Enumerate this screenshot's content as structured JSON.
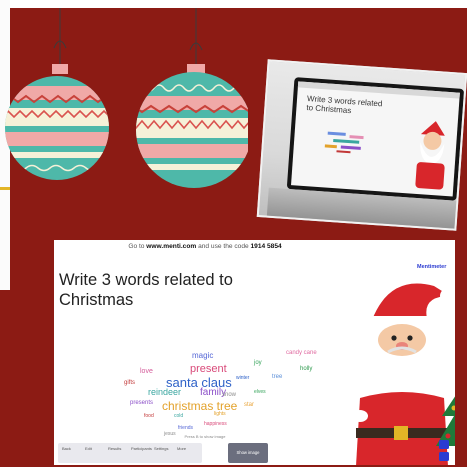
{
  "slide": {
    "code_prefix": "Go to ",
    "url": "www.menti.com",
    "code_middle": " and use the code ",
    "code": "1914 5854",
    "title": "Write 3 words related to Christmas",
    "press_note": "Press B to show image",
    "toolbar_items": [
      "Back",
      "Edit",
      "Results",
      "Participants",
      "Settings",
      "More"
    ],
    "show_button": "Show image",
    "brand": "Mentimeter"
  },
  "laptop_photo": {
    "screen_title": "Write 3 words related to Christmas"
  },
  "word_cloud": [
    {
      "text": "santa claus",
      "color": "#2f62c8"
    },
    {
      "text": "present",
      "color": "#d94b7a"
    },
    {
      "text": "family",
      "color": "#8b4fc8"
    },
    {
      "text": "christmas tree",
      "color": "#e3a22b"
    },
    {
      "text": "reindeer",
      "color": "#3aa6a0"
    },
    {
      "text": "magic",
      "color": "#5567d6"
    },
    {
      "text": "love",
      "color": "#d45b9a"
    },
    {
      "text": "joy",
      "color": "#35a35a"
    },
    {
      "text": "snow",
      "color": "#8d8d8d"
    },
    {
      "text": "gifts",
      "color": "#c23838"
    },
    {
      "text": "tree",
      "color": "#5b8fd8"
    },
    {
      "text": "holly",
      "color": "#2e9a4e"
    },
    {
      "text": "candy cane",
      "color": "#e06aa0"
    },
    {
      "text": "star",
      "color": "#e9a53c"
    },
    {
      "text": "presents",
      "color": "#8b4fc8"
    },
    {
      "text": "cold",
      "color": "#3aa6a0"
    },
    {
      "text": "winter",
      "color": "#2f62c8"
    },
    {
      "text": "food",
      "color": "#c23838"
    },
    {
      "text": "lights",
      "color": "#e3a22b"
    },
    {
      "text": "happiness",
      "color": "#d94b7a"
    },
    {
      "text": "friends",
      "color": "#5567d6"
    },
    {
      "text": "elves",
      "color": "#35a35a"
    },
    {
      "text": "jesus",
      "color": "#8d8d8d"
    }
  ],
  "colors": {
    "background": "#8c1b14",
    "ornament_teal": "#4eb8a9",
    "ornament_pink": "#f0a9a7",
    "ornament_red": "#c8423a",
    "ornament_cream": "#f6f1d8"
  }
}
